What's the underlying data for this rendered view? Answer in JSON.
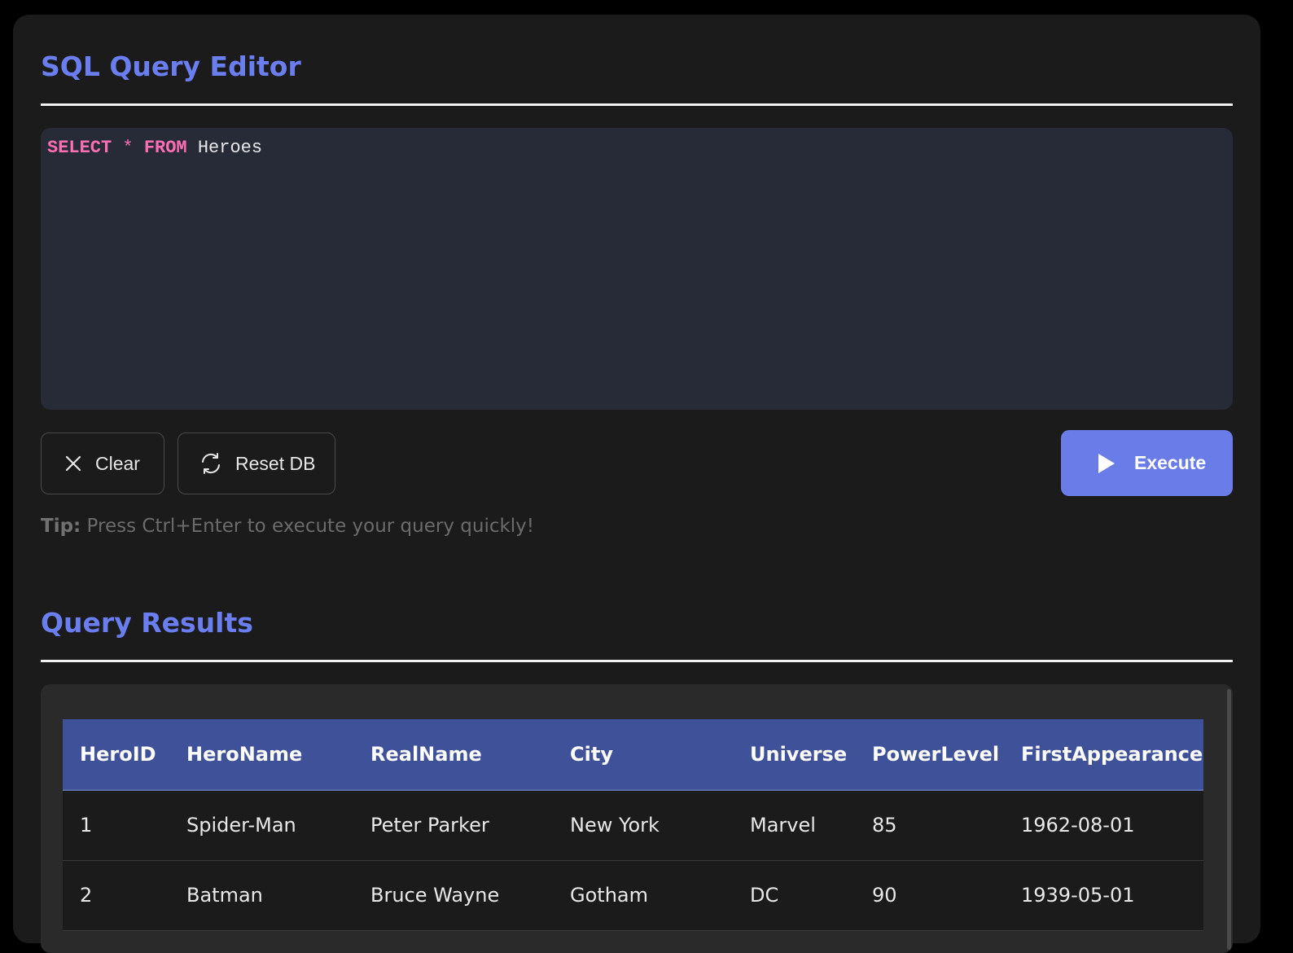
{
  "editor_section": {
    "title": "SQL Query Editor",
    "query": {
      "kw_select": "SELECT",
      "op_star": "*",
      "kw_from": "FROM",
      "table": "Heroes"
    }
  },
  "toolbar": {
    "clear_label": "Clear",
    "reset_label": "Reset DB",
    "execute_label": "Execute"
  },
  "tip": {
    "label": "Tip:",
    "text": " Press Ctrl+Enter to execute your query quickly!"
  },
  "results_section": {
    "title": "Query Results",
    "columns": [
      "HeroID",
      "HeroName",
      "RealName",
      "City",
      "Universe",
      "PowerLevel",
      "FirstAppearance"
    ],
    "rows": [
      [
        "1",
        "Spider-Man",
        "Peter Parker",
        "New York",
        "Marvel",
        "85",
        "1962-08-01"
      ],
      [
        "2",
        "Batman",
        "Bruce Wayne",
        "Gotham",
        "DC",
        "90",
        "1939-05-01"
      ]
    ]
  },
  "colors": {
    "accent": "#6a7ef0",
    "header_bg": "#3f5199",
    "keyword": "#ff6fb5",
    "execute_bg": "#6a7ce8"
  },
  "icons": {
    "clear": "close-icon",
    "reset": "refresh-icon",
    "execute": "play-icon"
  }
}
